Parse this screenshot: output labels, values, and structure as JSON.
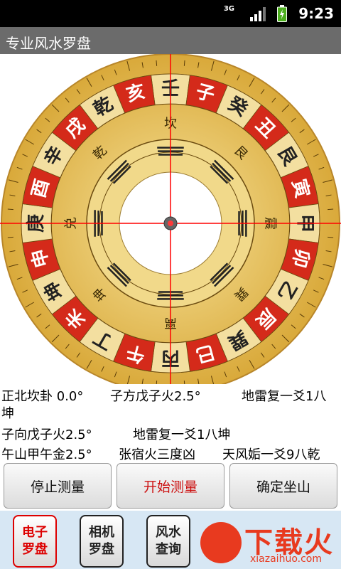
{
  "status_bar": {
    "network": "3G",
    "time": "9:23"
  },
  "app": {
    "title": "专业风水罗盘"
  },
  "compass": {
    "ring_outer_red": [
      "壬",
      "子",
      "癸",
      "丑",
      "艮",
      "寅",
      "甲",
      "卯",
      "乙",
      "辰",
      "巽",
      "巳",
      "丙",
      "午",
      "丁",
      "未",
      "坤",
      "申",
      "庚",
      "酉",
      "辛",
      "戌",
      "乾",
      "亥"
    ],
    "ring_mid": [
      "坎",
      "艮",
      "震",
      "巽",
      "离",
      "坤",
      "兑",
      "乾"
    ],
    "heading_deg": 0.0
  },
  "readout": {
    "line1_a": "正北坎卦  0.0°",
    "line1_b": "子方戊子火2.5°",
    "line1_c": "地雷复一爻1八",
    "line1_wrap": "坤",
    "line2_a": "子向戊子火2.5°",
    "line2_b": "地雷复一爻1八坤",
    "line3_a": "午山甲午金2.5°",
    "line3_b": "张宿火三度凶",
    "line3_c": "天风姤一爻9八乾"
  },
  "buttons": {
    "stop": "停止测量",
    "start": "开始测量",
    "confirm": "确定坐山"
  },
  "bottom_nav": [
    {
      "line1": "电子",
      "line2": "罗盘"
    },
    {
      "line1": "相机",
      "line2": "罗盘"
    },
    {
      "line1": "风水",
      "line2": "查询"
    }
  ],
  "watermark": {
    "word": "下载火",
    "domain": "xiazaihuo.com"
  },
  "colors": {
    "accent_red": "#cc1111",
    "gold": "#e8c14a",
    "status_bar": "#000000",
    "title_bar": "#6b6b6b",
    "nav_bg": "#d7e7f4"
  }
}
